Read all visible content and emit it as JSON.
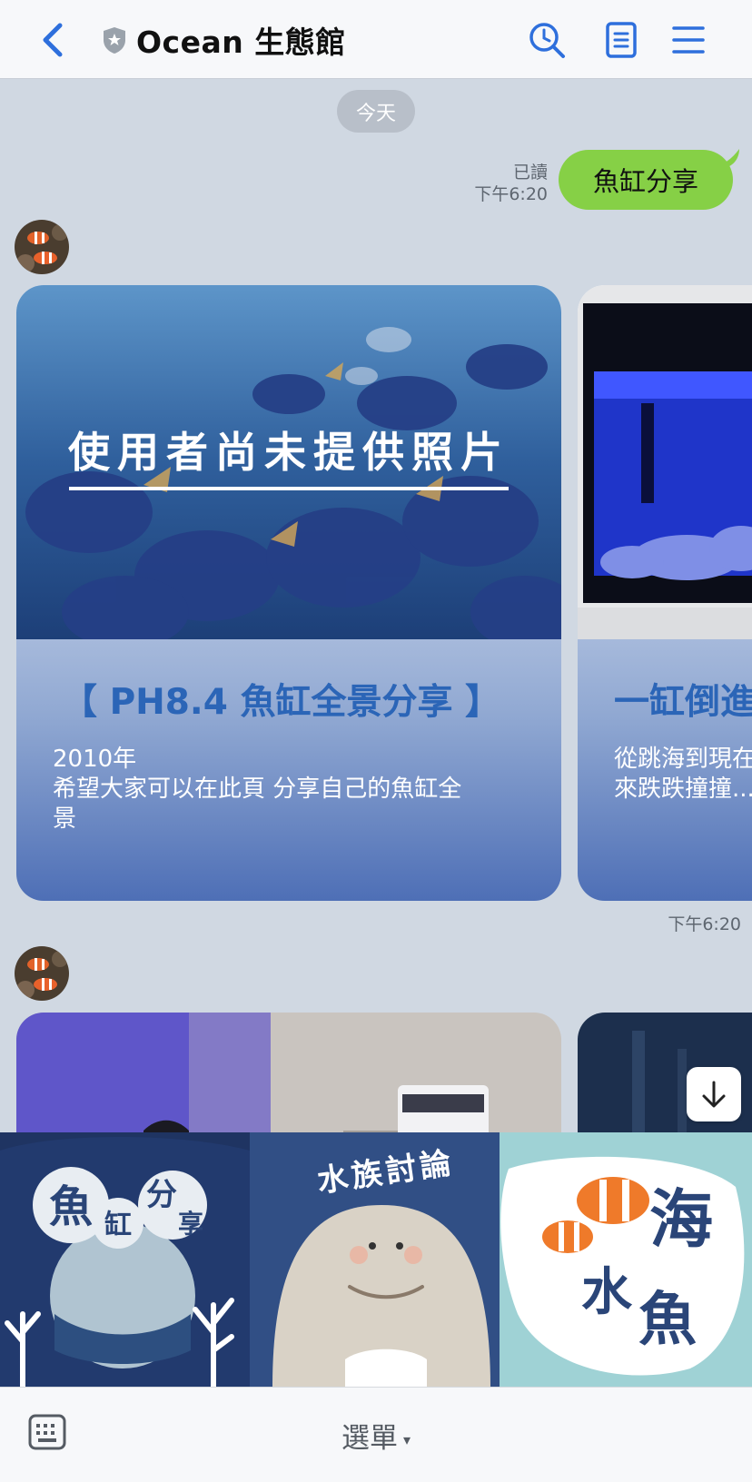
{
  "header": {
    "title": "Ocean 生態館",
    "icons": [
      "chevron-left-icon",
      "shield-star-icon",
      "search-history-icon",
      "notes-icon",
      "hamburger-menu-icon"
    ],
    "accent": "#2e6fdc"
  },
  "chat": {
    "date_label": "今天",
    "outgoing": {
      "read_status": "已讀",
      "time": "下午6:20",
      "text": "魚缸分享",
      "bubble_color": "#86d046"
    },
    "cards": [
      {
        "photo_caption": "使用者尚未提供照片",
        "title": "【 PH8.4 魚缸全景分享 】",
        "body_line1": "2010年",
        "body_line2": "希望大家可以在此頁 分享自己的魚缸全",
        "body_line3": "景"
      },
      {
        "title": "一缸倒進",
        "body_line1": "從跳海到現在",
        "body_line2": "來跌跌撞撞..."
      }
    ],
    "cards_time": "下午6:20"
  },
  "rich_menu": {
    "left_text": [
      "魚",
      "缸",
      "分",
      "享"
    ],
    "center_text": "水族討論",
    "right_text": [
      "海",
      "水",
      "魚"
    ]
  },
  "footer": {
    "menu_label": "選單",
    "caret": "▾"
  }
}
